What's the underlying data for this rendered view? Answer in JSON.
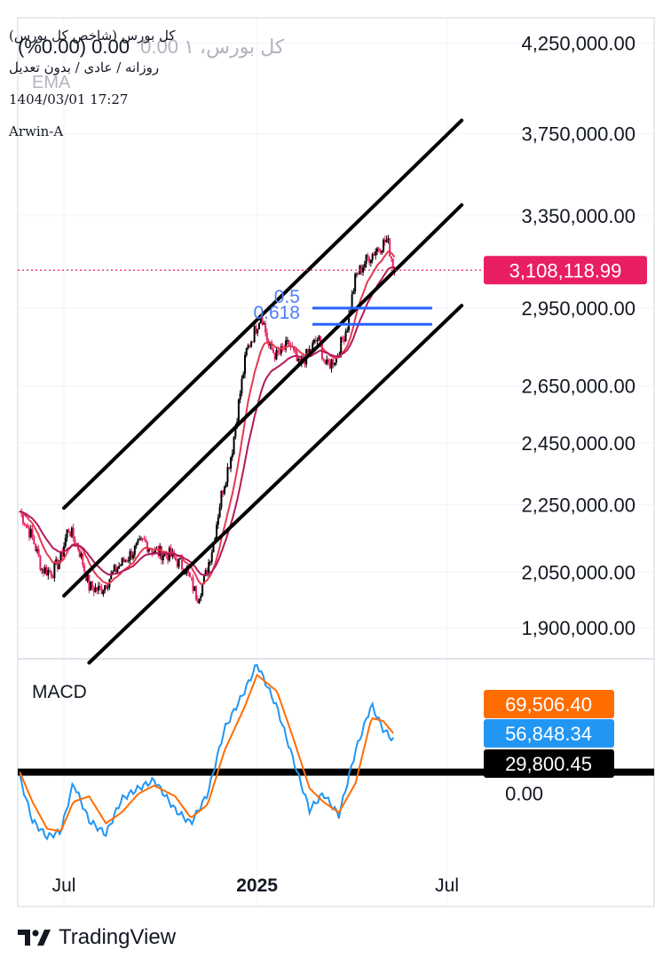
{
  "legend": {
    "symbol_title": "کل بورس (شاخص کل بورس)",
    "ghost_symbol": "کل بورس، ۱",
    "change_text": "0.00 (0.00%)",
    "ema_label": "EMA",
    "interval_line": "روزانه / عادی / بدون تعدیل",
    "timestamp": "1404/03/01 17:27",
    "author": "Arwin-A"
  },
  "branding": {
    "name": "TradingView",
    "logo_icon": "tradingview-logo-icon"
  },
  "colors": {
    "candle_up": "#000000",
    "candle_down": "#e91e63",
    "ema_fast": "#e53950",
    "ema_slow": "#b4195a",
    "channel": "#000000",
    "fib": "#2962ff",
    "fib_label": "#4f7df9",
    "price_label_bg": "#e91e63",
    "macd_line": "#2196f3",
    "signal_line": "#ff6d00",
    "histogram_label_bg": "#000000"
  },
  "chart_data": [
    {
      "type": "candlestick",
      "title": "کل بورس (شاخص کل بورس)",
      "y_scale": "log",
      "ylim": [
        1820000,
        4400000
      ],
      "y_ticks": [
        "4,250,000.00",
        "3,750,000.00",
        "3,350,000.00",
        "2,950,000.00",
        "2,650,000.00",
        "2,450,000.00",
        "2,250,000.00",
        "2,050,000.00",
        "1,900,000.00"
      ],
      "y_tick_values": [
        4250000,
        3750000,
        3350000,
        2950000,
        2650000,
        2450000,
        2250000,
        2050000,
        1900000
      ],
      "x_ticks": [
        "Jul",
        "2025",
        "Jul"
      ],
      "x_tick_dates": [
        "2024-07-01",
        "2025-01-01",
        "2025-07-01"
      ],
      "last_price": 3108118.99,
      "last_price_label": "3,108,118.99",
      "close_keypoints": [
        [
          "2024-05-20",
          2230000
        ],
        [
          "2024-06-01",
          2150000
        ],
        [
          "2024-06-10",
          2060000
        ],
        [
          "2024-06-20",
          2050000
        ],
        [
          "2024-06-28",
          2090000
        ],
        [
          "2024-07-05",
          2180000
        ],
        [
          "2024-07-15",
          2120000
        ],
        [
          "2024-07-25",
          2010000
        ],
        [
          "2024-08-05",
          2000000
        ],
        [
          "2024-08-20",
          2060000
        ],
        [
          "2024-09-05",
          2110000
        ],
        [
          "2024-09-15",
          2140000
        ],
        [
          "2024-09-25",
          2110000
        ],
        [
          "2024-10-10",
          2100000
        ],
        [
          "2024-10-25",
          2060000
        ],
        [
          "2024-11-05",
          1980000
        ],
        [
          "2024-11-12",
          2030000
        ],
        [
          "2024-11-20",
          2130000
        ],
        [
          "2024-11-28",
          2280000
        ],
        [
          "2024-12-08",
          2420000
        ],
        [
          "2024-12-15",
          2600000
        ],
        [
          "2024-12-22",
          2780000
        ],
        [
          "2024-12-28",
          2840000
        ],
        [
          "2025-01-05",
          2930000
        ],
        [
          "2025-01-12",
          2800000
        ],
        [
          "2025-01-20",
          2760000
        ],
        [
          "2025-02-01",
          2810000
        ],
        [
          "2025-02-10",
          2720000
        ],
        [
          "2025-02-20",
          2780000
        ],
        [
          "2025-02-28",
          2830000
        ],
        [
          "2025-03-08",
          2720000
        ],
        [
          "2025-03-18",
          2760000
        ],
        [
          "2025-03-28",
          2880000
        ],
        [
          "2025-04-05",
          3080000
        ],
        [
          "2025-04-15",
          3150000
        ],
        [
          "2025-04-25",
          3200000
        ],
        [
          "2025-05-05",
          3240000
        ],
        [
          "2025-05-12",
          3108118.99
        ]
      ],
      "fibonacci": [
        {
          "level": "0.5",
          "value": 2950000
        },
        {
          "level": "0.618",
          "value": 2885000
        }
      ],
      "channel_lines": [
        {
          "from": [
            "2024-07-01",
            2240000
          ],
          "to": [
            "2025-07-15",
            3820000
          ]
        },
        {
          "from": [
            "2024-07-01",
            1985000
          ],
          "to": [
            "2025-07-15",
            3400000
          ]
        },
        {
          "from": [
            "2024-07-25",
            1810000
          ],
          "to": [
            "2025-07-15",
            2960000
          ]
        }
      ]
    },
    {
      "type": "line",
      "title": "MACD",
      "ylim": [
        -190000,
        210000
      ],
      "y_ticks": [
        "0.00"
      ],
      "y_tick_values": [
        0
      ],
      "zero_line_value": 0,
      "series": [
        {
          "key": "macd",
          "last": 56848.34,
          "last_label": "56,848.34",
          "keypoints": [
            [
              "2024-05-20",
              -10000
            ],
            [
              "2024-06-01",
              -90000
            ],
            [
              "2024-06-15",
              -120000
            ],
            [
              "2024-06-28",
              -110000
            ],
            [
              "2024-07-10",
              -20000
            ],
            [
              "2024-07-25",
              -90000
            ],
            [
              "2024-08-10",
              -115000
            ],
            [
              "2024-08-25",
              -50000
            ],
            [
              "2024-09-10",
              -30000
            ],
            [
              "2024-09-25",
              -15000
            ],
            [
              "2024-10-15",
              -70000
            ],
            [
              "2024-10-30",
              -95000
            ],
            [
              "2024-11-15",
              -40000
            ],
            [
              "2024-12-01",
              80000
            ],
            [
              "2024-12-20",
              150000
            ],
            [
              "2025-01-01",
              200000
            ],
            [
              "2025-01-20",
              120000
            ],
            [
              "2025-02-05",
              20000
            ],
            [
              "2025-02-20",
              -70000
            ],
            [
              "2025-03-05",
              -40000
            ],
            [
              "2025-03-20",
              -80000
            ],
            [
              "2025-04-05",
              40000
            ],
            [
              "2025-04-20",
              125000
            ],
            [
              "2025-05-01",
              80000
            ],
            [
              "2025-05-12",
              56848.34
            ]
          ]
        },
        {
          "key": "signal",
          "last": 69506.4,
          "last_label": "69,506.40",
          "keypoints": [
            [
              "2024-05-20",
              0
            ],
            [
              "2024-06-01",
              -55000
            ],
            [
              "2024-06-15",
              -105000
            ],
            [
              "2024-06-28",
              -110000
            ],
            [
              "2024-07-10",
              -55000
            ],
            [
              "2024-07-25",
              -45000
            ],
            [
              "2024-08-10",
              -95000
            ],
            [
              "2024-08-25",
              -75000
            ],
            [
              "2024-09-10",
              -40000
            ],
            [
              "2024-09-25",
              -25000
            ],
            [
              "2024-10-15",
              -45000
            ],
            [
              "2024-10-30",
              -85000
            ],
            [
              "2024-11-15",
              -60000
            ],
            [
              "2024-12-01",
              40000
            ],
            [
              "2024-12-20",
              120000
            ],
            [
              "2025-01-01",
              180000
            ],
            [
              "2025-01-20",
              150000
            ],
            [
              "2025-02-05",
              60000
            ],
            [
              "2025-02-20",
              -30000
            ],
            [
              "2025-03-05",
              -55000
            ],
            [
              "2025-03-20",
              -75000
            ],
            [
              "2025-04-05",
              -20000
            ],
            [
              "2025-04-20",
              100000
            ],
            [
              "2025-05-01",
              95000
            ],
            [
              "2025-05-12",
              69506.4
            ]
          ]
        }
      ],
      "histogram_last": 29800.45,
      "histogram_last_label": "29,800.45"
    }
  ]
}
